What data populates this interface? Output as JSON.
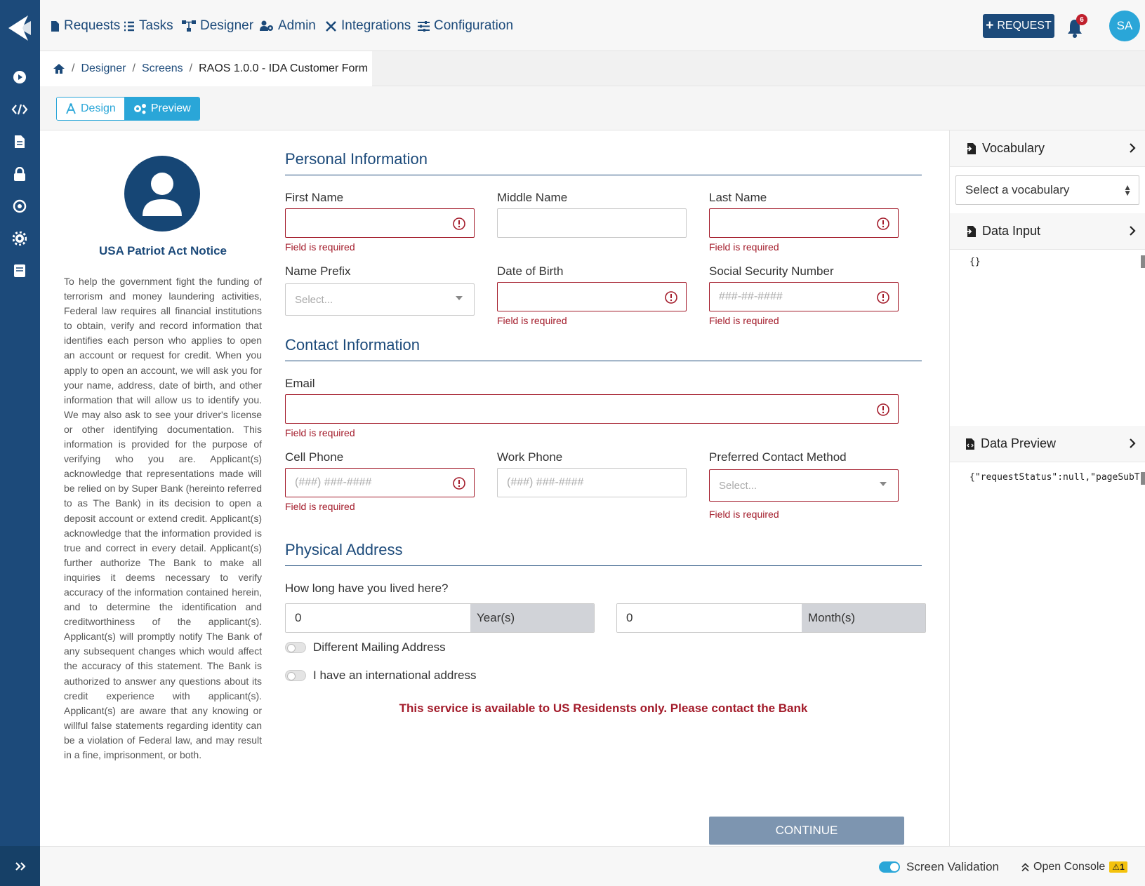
{
  "nav": {
    "items": [
      {
        "label": "Requests",
        "icon": "file-icon"
      },
      {
        "label": "Tasks",
        "icon": "list-icon"
      },
      {
        "label": "Designer",
        "icon": "sitemap-icon"
      },
      {
        "label": "Admin",
        "icon": "users-cog-icon"
      },
      {
        "label": "Integrations",
        "icon": "tools-icon"
      },
      {
        "label": "Configuration",
        "icon": "sliders-icon"
      }
    ],
    "request_button": "REQUEST",
    "notification_count": "6",
    "user_initials": "SA"
  },
  "breadcrumb": {
    "items": [
      "Designer",
      "Screens"
    ],
    "current": "RAOS 1.0.0 - IDA Customer Form"
  },
  "mode": {
    "design": "Design",
    "preview": "Preview"
  },
  "notice": {
    "title": "USA Patriot Act Notice",
    "body": "To help the government fight the funding of terrorism and money laundering activities, Federal law requires all financial institutions to obtain, verify and record information that identifies each person who applies to open an account or request for credit. When you apply to open an account, we will ask you for your name, address, date of birth, and other information that will allow us to identify you. We may also ask to see your driver's license or other identifying documentation. This information is provided for the purpose of verifying who you are. Applicant(s) acknowledge that representations made will be relied on by Super Bank (hereinto referred to as The Bank) in its decision to open a deposit account or extend credit. Applicant(s) acknowledge that the information provided is true and correct in every detail. Applicant(s) further authorize The Bank to make all inquiries it deems necessary to verify accuracy of the information contained herein, and to determine the identification and creditworthiness of the applicant(s). Applicant(s) will promptly notify The Bank of any subsequent changes which would affect the accuracy of this statement. The Bank is authorized to answer any questions about its credit experience with applicant(s). Applicant(s) are aware that any knowing or willful false statements regarding identity can be a violation of Federal law, and may result in a fine, imprisonment, or both."
  },
  "form": {
    "personal_title": "Personal Information",
    "contact_title": "Contact Information",
    "address_title": "Physical Address",
    "error_text": "Field is required",
    "first_name": "First Name",
    "middle_name": "Middle Name",
    "last_name": "Last Name",
    "name_prefix": "Name Prefix",
    "name_prefix_placeholder": "Select...",
    "dob": "Date of Birth",
    "ssn": "Social Security Number",
    "ssn_placeholder": "###-##-####",
    "email": "Email",
    "cell_phone": "Cell Phone",
    "cell_phone_placeholder": "(###) ###-####",
    "work_phone": "Work Phone",
    "work_phone_placeholder": "(###) ###-####",
    "preferred_contact": "Preferred Contact Method",
    "preferred_contact_placeholder": "Select...",
    "lived_here": "How long have you lived here?",
    "years_value": "0",
    "years_addon": "Year(s)",
    "months_value": "0",
    "months_addon": "Month(s)",
    "mailing_toggle": "Different Mailing Address",
    "international_toggle": "I have an international address",
    "warning": "This service is available to US Residensts only. Please contact the Bank",
    "continue": "CONTINUE"
  },
  "panel": {
    "vocabulary": "Vocabulary",
    "vocabulary_select": "Select a vocabulary",
    "data_input": "Data Input",
    "data_input_code": "{}",
    "data_preview": "Data Preview",
    "data_preview_code": "{\"requestStatus\":null,\"pageSubT"
  },
  "footer": {
    "screen_validation": "Screen Validation",
    "open_console": "Open Console",
    "warning_count": "1"
  },
  "colors": {
    "brand": "#1c4a7a",
    "accent": "#2aa6d8",
    "error": "#a31b2a"
  }
}
